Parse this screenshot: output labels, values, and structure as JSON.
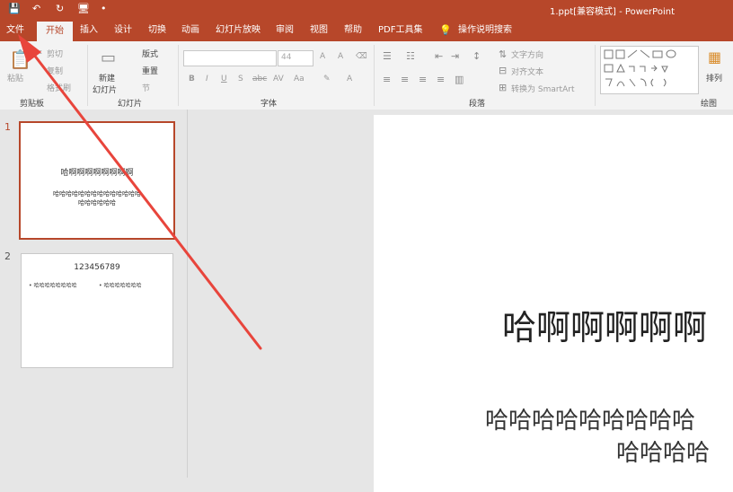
{
  "titlebar": {
    "title": "1.ppt[兼容模式] - PowerPoint",
    "qa_save": "💾",
    "qa_undo": "↶",
    "qa_redo": "↻",
    "qa_present": "🖥",
    "qa_more": "•"
  },
  "tabs": [
    "文件",
    "开始",
    "插入",
    "设计",
    "切换",
    "动画",
    "幻灯片放映",
    "审阅",
    "视图",
    "帮助",
    "PDF工具集",
    "操作说明搜索"
  ],
  "ribbon": {
    "clipboard": {
      "paste": "粘贴",
      "cut": "剪切",
      "copy": "复制",
      "format_painter": "格式刷",
      "label": "剪贴板"
    },
    "slides": {
      "new_slide": "新建",
      "new_slide2": "幻灯片",
      "layout": "版式",
      "reset": "重置",
      "section": "节",
      "label": "幻灯片"
    },
    "font": {
      "size": "44",
      "bold": "B",
      "italic": "I",
      "underline": "U",
      "shadow": "S",
      "strike": "abc",
      "spacing": "AV",
      "case": "Aa",
      "clear": "A",
      "label": "字体"
    },
    "paragraph": {
      "text_dir": "文字方向",
      "align_text": "对齐文本",
      "smartart": "转换为 SmartArt",
      "label": "段落"
    },
    "drawing": {
      "arrange": "排列",
      "label": "绘图"
    }
  },
  "thumbnails": [
    {
      "num": "1",
      "title": "哈啊啊啊啊啊啊啊啊",
      "body_line1": "哈哈哈哈哈哈哈哈哈哈哈哈哈哈",
      "body_line2": "哈哈哈哈哈哈"
    },
    {
      "num": "2",
      "title": "123456789",
      "bullet1": "哈哈哈哈哈哈哈哈",
      "bullet2": "哈哈哈哈哈哈哈"
    }
  ],
  "slide": {
    "title": "哈啊啊啊啊啊",
    "body_line1": "哈哈哈哈哈哈哈哈哈",
    "body_line2": "哈哈哈哈"
  },
  "colors": {
    "accent": "#b7472a",
    "annotation": "#e8453c"
  }
}
